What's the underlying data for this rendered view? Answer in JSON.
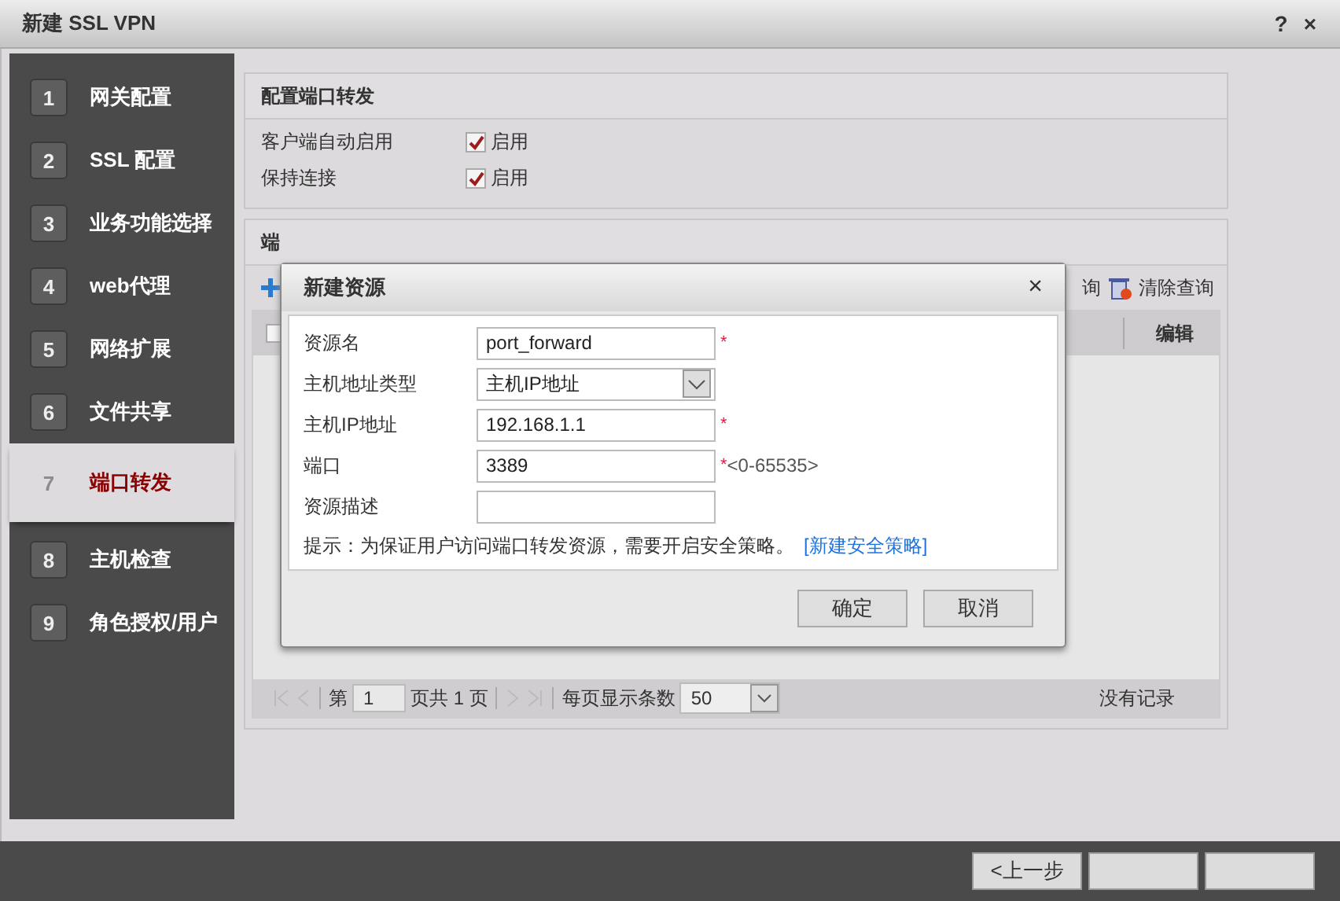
{
  "window": {
    "title": "新建 SSL VPN",
    "help": "?",
    "close": "×"
  },
  "steps": [
    {
      "number": "1",
      "label": "网关配置",
      "selected": false
    },
    {
      "number": "2",
      "label": "SSL 配置",
      "selected": false
    },
    {
      "number": "3",
      "label": "业务功能选择",
      "selected": false
    },
    {
      "number": "4",
      "label": "web代理",
      "selected": false
    },
    {
      "number": "5",
      "label": "网络扩展",
      "selected": false
    },
    {
      "number": "6",
      "label": "文件共享",
      "selected": false
    },
    {
      "number": "7",
      "label": "端口转发",
      "selected": true
    },
    {
      "number": "8",
      "label": "主机检查",
      "selected": false
    },
    {
      "number": "9",
      "label": "角色授权/用户",
      "selected": false
    }
  ],
  "config_panel": {
    "title": "配置端口转发",
    "options": [
      {
        "label": "客户端自动启用",
        "checkbox": "启用",
        "checked": true
      },
      {
        "label": "保持连接",
        "checkbox": "启用",
        "checked": true
      }
    ]
  },
  "resource_panel": {
    "title": "端",
    "toolbar": {
      "search": "询",
      "clear": "清除查询"
    },
    "select_all": {
      "checked": false
    },
    "columns": [
      {
        "label": "编辑"
      }
    ],
    "pager": {
      "page_prefix": "第",
      "page": "1",
      "page_total": "页共 1 页",
      "per_page_label": "每页显示条数",
      "per_page": "50",
      "status": "没有记录"
    }
  },
  "dialog": {
    "title": "新建资源",
    "close": "×",
    "fields": [
      {
        "label": "资源名",
        "kind": "text",
        "value": "port_forward",
        "required_mark": "*"
      },
      {
        "label": "主机地址类型",
        "kind": "select",
        "value": "主机IP地址"
      },
      {
        "label": "主机IP地址",
        "kind": "text",
        "value": "192.168.1.1",
        "required_mark": "*"
      },
      {
        "label": "端口",
        "kind": "text",
        "value": "3389",
        "required_mark": "*",
        "hint": "<0-65535>"
      },
      {
        "label": "资源描述",
        "kind": "text"
      }
    ],
    "tip": "提示：为保证用户访问端口转发资源，需要开启安全策略。",
    "tip_link": "[新建安全策略]",
    "buttons": [
      "确定",
      "取消"
    ]
  },
  "footer_buttons": [
    {
      "kind": "button",
      "label": "<上一步"
    },
    {
      "kind": "button"
    },
    {
      "kind": "button"
    }
  ]
}
